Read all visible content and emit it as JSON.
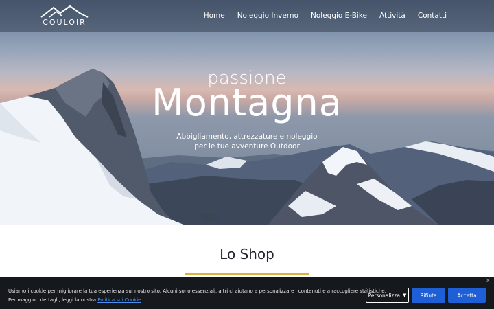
{
  "brand": {
    "name": "COULOIR"
  },
  "nav": {
    "items": [
      "Home",
      "Noleggio Inverno",
      "Noleggio E-Bike",
      "Attività",
      "Contatti"
    ]
  },
  "hero": {
    "subtitle": "passione",
    "title": "Montagna",
    "tagline_line1": "Abbigliamento, attrezzature e noleggio",
    "tagline_line2": "per le tue avventure Outdoor"
  },
  "shop": {
    "title": "Lo Shop"
  },
  "cookie": {
    "text_line1": "Usiamo i cookie per migliorare la tua esperienza sul nostro sito. Alcuni sono essenziali, altri ci aiutano a personalizzare i contenuti e a raccogliere statistiche.",
    "text_line2_prefix": "Per maggiori dettagli, leggi la nostra ",
    "policy_link": "Politica sui Cookie",
    "customize_label": "Personalizza",
    "reject_label": "Rifiuta",
    "accept_label": "Accetta",
    "close_glyph": "×"
  },
  "colors": {
    "accent_rule": "#d8b43c",
    "button_blue": "#1f5fd6",
    "cookie_bg": "#15181c"
  },
  "icons": [
    "mountain-logo-icon",
    "caret-down-icon",
    "close-icon"
  ]
}
